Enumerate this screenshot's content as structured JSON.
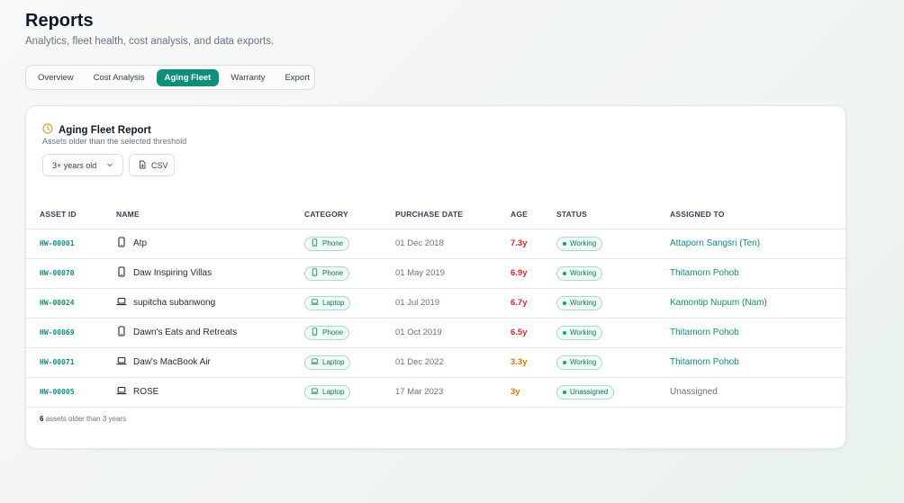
{
  "header": {
    "title": "Reports",
    "subtitle": "Analytics, fleet health, cost analysis, and data exports."
  },
  "tabs": [
    {
      "label": "Overview",
      "active": false
    },
    {
      "label": "Cost Analysis",
      "active": false
    },
    {
      "label": "Aging Fleet",
      "active": true
    },
    {
      "label": "Warranty",
      "active": false
    },
    {
      "label": "Export",
      "active": false
    }
  ],
  "report": {
    "title": "Aging Fleet Report",
    "subtitle": "Assets older than the selected threshold",
    "threshold_selected": "3+ years old",
    "csv_label": "CSV",
    "icon": "clock-icon",
    "accent_color": "#e0a03c"
  },
  "table": {
    "columns": [
      "ASSET ID",
      "NAME",
      "CATEGORY",
      "PURCHASE DATE",
      "AGE",
      "STATUS",
      "ASSIGNED TO"
    ],
    "rows": [
      {
        "asset_id": "HW-00001",
        "name": "Atp",
        "device_icon": "phone-icon",
        "category": "Phone",
        "purchase_date": "01 Dec 2018",
        "age": "7.3y",
        "age_level": "red",
        "status": "Working",
        "assigned_to": "Attaporn Sangsri (Ten)"
      },
      {
        "asset_id": "HW-00070",
        "name": "Daw Inspiring Villas",
        "device_icon": "phone-icon",
        "category": "Phone",
        "purchase_date": "01 May 2019",
        "age": "6.9y",
        "age_level": "red",
        "status": "Working",
        "assigned_to": "Thitamorn Pohob"
      },
      {
        "asset_id": "HW-00024",
        "name": "supitcha subanwong",
        "device_icon": "laptop-icon",
        "category": "Laptop",
        "purchase_date": "01 Jul 2019",
        "age": "6.7y",
        "age_level": "red",
        "status": "Working",
        "assigned_to": "Kamontip Nupum (Nam)"
      },
      {
        "asset_id": "HW-00069",
        "name": "Dawn's Eats and Retreats",
        "device_icon": "phone-icon",
        "category": "Phone",
        "purchase_date": "01 Oct 2019",
        "age": "6.5y",
        "age_level": "red",
        "status": "Working",
        "assigned_to": "Thitamorn Pohob"
      },
      {
        "asset_id": "HW-00071",
        "name": "Daw's MacBook Air",
        "device_icon": "laptop-icon",
        "category": "Laptop",
        "purchase_date": "01 Dec 2022",
        "age": "3.3y",
        "age_level": "orange",
        "status": "Working",
        "assigned_to": "Thitamorn Pohob"
      },
      {
        "asset_id": "HW-00005",
        "name": "ROSE",
        "device_icon": "laptop-icon",
        "category": "Laptop",
        "purchase_date": "17 Mar 2023",
        "age": "3y",
        "age_level": "orange",
        "status": "Unassigned",
        "assigned_to": "Unassigned"
      }
    ]
  },
  "footer": {
    "count": "6",
    "text": "assets older than 3 years"
  },
  "colors": {
    "accent": "#0e8f78",
    "age_red": "#dc2626",
    "age_orange": "#d97706"
  }
}
